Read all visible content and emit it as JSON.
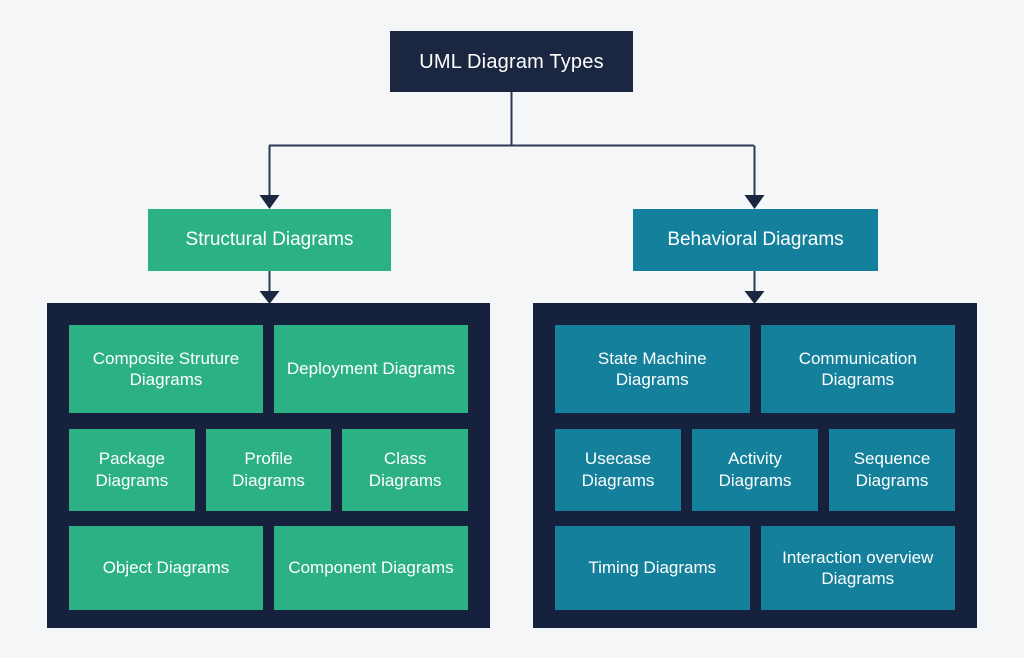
{
  "title": "UML Diagram Types",
  "colors": {
    "background": "#f5f6f7",
    "root": "#1b2741",
    "panel": "#16213e",
    "structural": "#2bb184",
    "behavioral": "#14809b",
    "connector": "#2b3a55",
    "text": "#ffffff"
  },
  "root": {
    "label": "UML Diagram Types"
  },
  "branches": [
    {
      "key": "structural",
      "label": "Structural Diagrams",
      "color": "#2bb184",
      "rows": [
        [
          {
            "label": "Composite Struture Diagrams",
            "flex": 1
          },
          {
            "label": "Deployment Diagrams",
            "flex": 1
          }
        ],
        [
          {
            "label": "Package Diagrams",
            "flex": 1
          },
          {
            "label": "Profile Diagrams",
            "flex": 1
          },
          {
            "label": "Class Diagrams",
            "flex": 1
          }
        ],
        [
          {
            "label": "Object Diagrams",
            "flex": 1
          },
          {
            "label": "Component Diagrams",
            "flex": 1
          }
        ]
      ]
    },
    {
      "key": "behavioral",
      "label": "Behavioral Diagrams",
      "color": "#14809b",
      "rows": [
        [
          {
            "label": "State Machine Diagrams",
            "flex": 1
          },
          {
            "label": "Communication Diagrams",
            "flex": 1
          }
        ],
        [
          {
            "label": "Usecase Diagrams",
            "flex": 1
          },
          {
            "label": "Activity Diagrams",
            "flex": 1
          },
          {
            "label": "Sequence Diagrams",
            "flex": 1
          }
        ],
        [
          {
            "label": "Timing Diagrams",
            "flex": 1
          },
          {
            "label": "Interaction overview Diagrams",
            "flex": 1
          }
        ]
      ]
    }
  ]
}
